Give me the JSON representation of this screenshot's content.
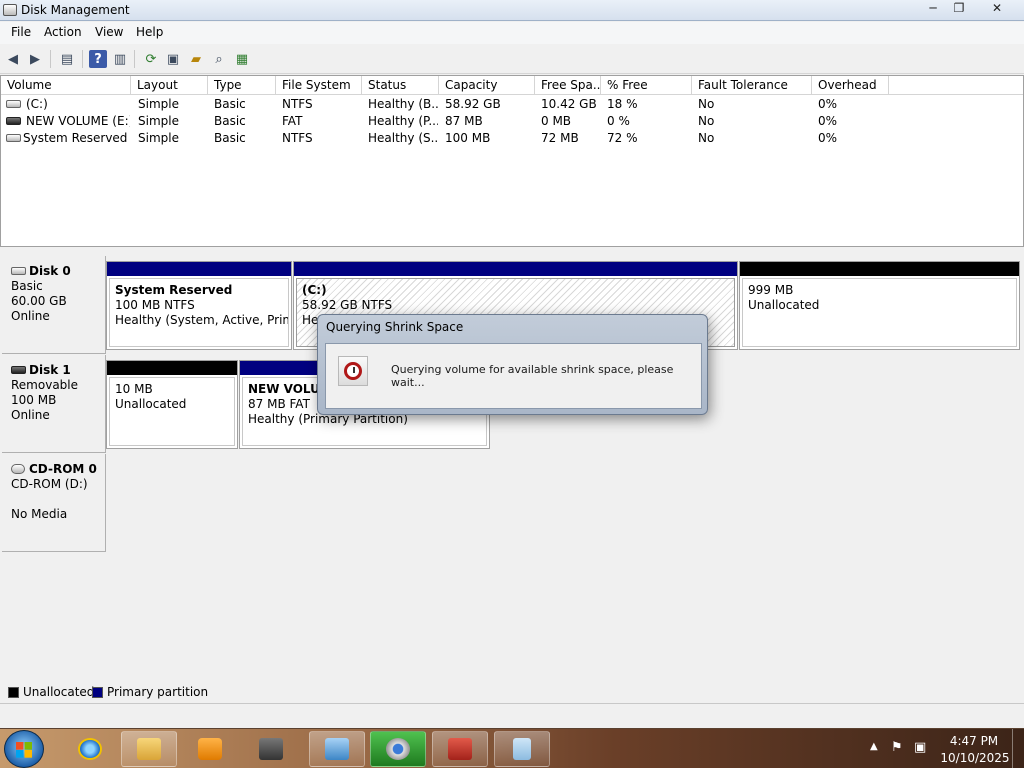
{
  "window": {
    "title": "Disk Management",
    "controls": {
      "minimize": "─",
      "maximize": "❐",
      "close": "✕"
    }
  },
  "menu": [
    "File",
    "Action",
    "View",
    "Help"
  ],
  "toolbar": {
    "icons": [
      "back-arrow-icon",
      "forward-arrow-icon",
      "console-tree-icon",
      "help-icon",
      "show-pane-icon",
      "refresh-icon",
      "properties-icon",
      "open-folder-icon",
      "rescan-disks-icon",
      "export-list-icon"
    ]
  },
  "volume_list": {
    "columns": [
      "Volume",
      "Layout",
      "Type",
      "File System",
      "Status",
      "Capacity",
      "Free Spa...",
      "% Free",
      "Fault Tolerance",
      "Overhead"
    ],
    "rows": [
      {
        "volume": "(C:)",
        "layout": "Simple",
        "type": "Basic",
        "fs": "NTFS",
        "status": "Healthy (B...",
        "capacity": "58.92 GB",
        "free": "10.42 GB",
        "pct": "18 %",
        "fault": "No",
        "overhead": "0%"
      },
      {
        "volume": "NEW VOLUME (E:)",
        "layout": "Simple",
        "type": "Basic",
        "fs": "FAT",
        "status": "Healthy (P...",
        "capacity": "87 MB",
        "free": "0 MB",
        "pct": "0 %",
        "fault": "No",
        "overhead": "0%"
      },
      {
        "volume": "System Reserved",
        "layout": "Simple",
        "type": "Basic",
        "fs": "NTFS",
        "status": "Healthy (S...",
        "capacity": "100 MB",
        "free": "72 MB",
        "pct": "72 %",
        "fault": "No",
        "overhead": "0%"
      }
    ]
  },
  "disks": [
    {
      "name": "Disk 0",
      "kind": "Basic",
      "size": "60.00 GB",
      "state": "Online"
    },
    {
      "name": "Disk 1",
      "kind": "Removable",
      "size": "100 MB",
      "state": "Online"
    },
    {
      "name": "CD-ROM 0",
      "kind": "CD-ROM (D:)",
      "size": "",
      "state": "No Media"
    }
  ],
  "partitions": {
    "disk0": [
      {
        "name": "System Reserved",
        "size": "100 MB NTFS",
        "status": "Healthy (System, Active, Primary"
      },
      {
        "name": "(C:)",
        "size": "58.92 GB NTFS",
        "status": "Heal"
      },
      {
        "name": "",
        "size": "999 MB",
        "status": "Unallocated"
      }
    ],
    "disk1": [
      {
        "name": "",
        "size": "10 MB",
        "status": "Unallocated"
      },
      {
        "name": "NEW VOLUM",
        "size": "87 MB FAT",
        "status": "Healthy (Primary Partition)"
      }
    ]
  },
  "colors": {
    "primary_partition": "#000080",
    "unallocated": "#000000"
  },
  "dialog": {
    "title": "Querying Shrink Space",
    "message": "Querying volume for available shrink space, please wait...",
    "icon": "clock-icon"
  },
  "legend": [
    {
      "label": "Unallocated",
      "color": "#000000"
    },
    {
      "label": "Primary partition",
      "color": "#000080"
    }
  ],
  "taskbar": {
    "apps": [
      "internet-explorer-icon",
      "file-explorer-icon",
      "media-player-icon",
      "user-folder-icon",
      "control-panel-icon",
      "chrome-icon",
      "toolbox-icon",
      "document-icon"
    ],
    "time": "4:47 PM",
    "date": "10/10/2025"
  }
}
